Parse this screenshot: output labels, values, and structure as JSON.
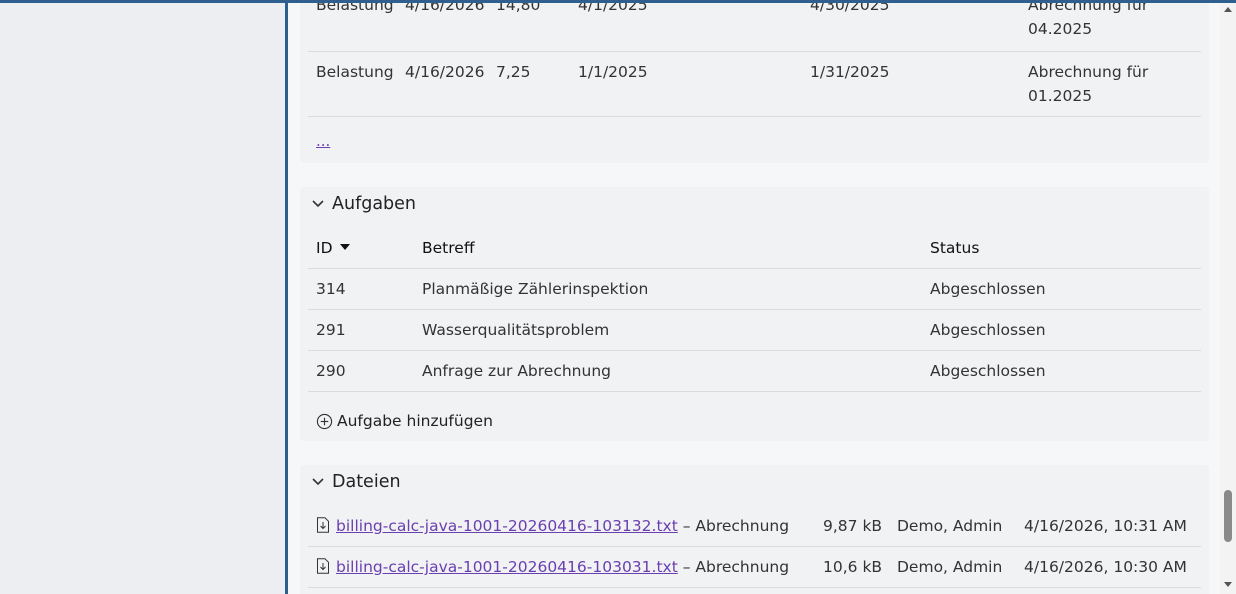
{
  "charges": {
    "rows": [
      {
        "type": "Belastung",
        "date": "4/16/2026",
        "amount": "14,80",
        "from": "4/1/2025",
        "to": "4/30/2025",
        "desc1": "Abrechnung für",
        "desc2": "04.2025"
      },
      {
        "type": "Belastung",
        "date": "4/16/2026",
        "amount": "7,25",
        "from": "1/1/2025",
        "to": "1/31/2025",
        "desc1": "Abrechnung für",
        "desc2": "01.2025"
      }
    ],
    "more_label": "..."
  },
  "tasks": {
    "title": "Aufgaben",
    "headers": {
      "id": "ID",
      "subject": "Betreff",
      "status": "Status"
    },
    "rows": [
      {
        "id": "314",
        "subject": "Planmäßige Zählerinspektion",
        "status": "Abgeschlossen"
      },
      {
        "id": "291",
        "subject": "Wasserqualitätsproblem",
        "status": "Abgeschlossen"
      },
      {
        "id": "290",
        "subject": "Anfrage zur Abrechnung",
        "status": "Abgeschlossen"
      }
    ],
    "add_label": "Aufgabe hinzufügen"
  },
  "files": {
    "title": "Dateien",
    "rows": [
      {
        "name": "billing-calc-java-1001-20260416-103132.txt",
        "suffix": " – Abrechnung",
        "size": "9,87 kB",
        "owner": "Demo, Admin",
        "date": "4/16/2026, 10:31 AM"
      },
      {
        "name": "billing-calc-java-1001-20260416-103031.txt",
        "suffix": " – Abrechnung",
        "size": "10,6 kB",
        "owner": "Demo, Admin",
        "date": "4/16/2026, 10:30 AM"
      }
    ]
  },
  "icons": {
    "chevron": "chevron-down-icon",
    "sort": "sort-desc-icon",
    "add": "plus-circle-icon",
    "file": "file-download-icon"
  },
  "colors": {
    "accent": "#2f5f8f",
    "link": "#6a3fb0"
  }
}
